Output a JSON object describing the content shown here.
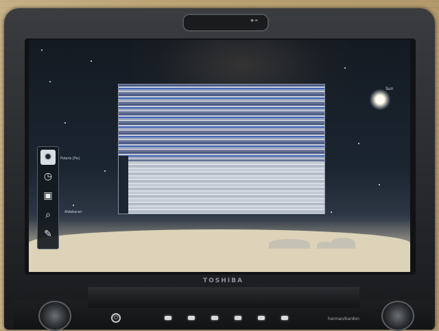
{
  "photo": {
    "laptop": {
      "brand_label": "TOSHIBA",
      "speaker_label": "harman/kardon"
    },
    "screen": {
      "sky_labels": {
        "sun": "Sun",
        "object_near_toolbar": "Polaris [Pe]",
        "object_lower": "Aldebaran"
      },
      "toolbar_icons": [
        "sky-icon",
        "clock-icon",
        "view-icon",
        "search-icon",
        "tools-icon"
      ],
      "status_bar": [
        "…",
        "…",
        "…",
        "…"
      ]
    },
    "colors": {
      "table": "#c7b187",
      "laptop": "#2a2c2f",
      "night_sky": "#141a22",
      "horizon": "#ddd3b8",
      "glitch_blue": "#3f62b7"
    }
  }
}
